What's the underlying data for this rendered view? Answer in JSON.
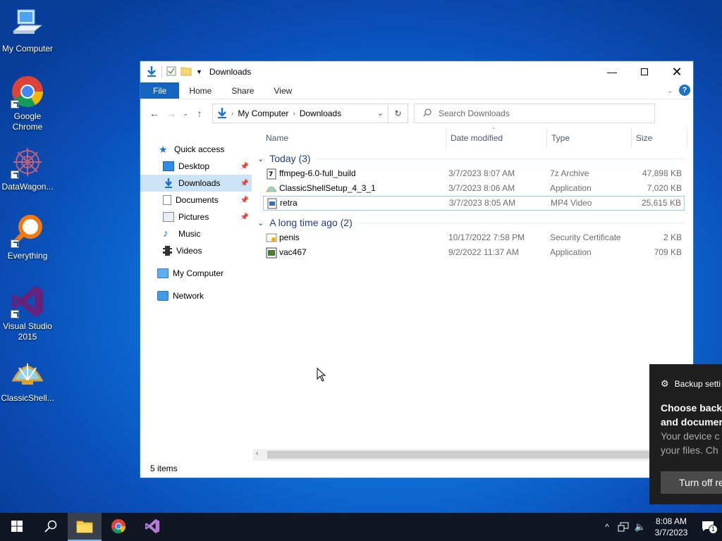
{
  "desktop": {
    "icons": [
      {
        "label": "My Computer",
        "icon": "computer-icon"
      },
      {
        "label": "Google Chrome",
        "icon": "chrome-icon"
      },
      {
        "label": "DataWagon...",
        "icon": "datawagon-icon"
      },
      {
        "label": "Everything",
        "icon": "search-magnifier-icon"
      },
      {
        "label": "Visual Studio 2015",
        "icon": "visual-studio-icon"
      },
      {
        "label": "ClassicShell...",
        "icon": "shell-icon"
      }
    ]
  },
  "window": {
    "title": "Downloads",
    "ribbon_tabs": [
      "File",
      "Home",
      "Share",
      "View"
    ],
    "help_label": "?",
    "breadcrumb": [
      "My Computer",
      "Downloads"
    ],
    "search_placeholder": "Search Downloads",
    "nav": {
      "quick_access": "Quick access",
      "items": [
        {
          "label": "Desktop",
          "pinned": true
        },
        {
          "label": "Downloads",
          "pinned": true,
          "selected": true
        },
        {
          "label": "Documents",
          "pinned": true
        },
        {
          "label": "Pictures",
          "pinned": true
        },
        {
          "label": "Music",
          "pinned": false
        },
        {
          "label": "Videos",
          "pinned": false
        }
      ],
      "my_computer": "My Computer",
      "network": "Network"
    },
    "columns": [
      "Name",
      "Date modified",
      "Type",
      "Size"
    ],
    "groups": [
      {
        "label": "Today (3)",
        "files": [
          {
            "name": "ffmpeg-6.0-full_build",
            "date": "3/7/2023 8:07 AM",
            "type": "7z Archive",
            "size": "47,898 KB"
          },
          {
            "name": "ClassicShellSetup_4_3_1",
            "date": "3/7/2023 8:06 AM",
            "type": "Application",
            "size": "7,020 KB"
          },
          {
            "name": "retra",
            "date": "3/7/2023 8:05 AM",
            "type": "MP4 Video",
            "size": "25,615 KB"
          }
        ]
      },
      {
        "label": "A long time ago (2)",
        "files": [
          {
            "name": "penis",
            "date": "10/17/2022 7:58 PM",
            "type": "Security Certificate",
            "size": "2 KB"
          },
          {
            "name": "vac467",
            "date": "9/2/2022 11:37 AM",
            "type": "Application",
            "size": "709 KB"
          }
        ]
      }
    ],
    "status": "5 items"
  },
  "notification": {
    "app": "Backup setti",
    "heading_line1": "Choose back",
    "heading_line2": "and documer",
    "body_line1": "Your device c",
    "body_line2": "your files. Ch",
    "button": "Turn off re"
  },
  "taskbar": {
    "time": "8:08 AM",
    "date": "3/7/2023",
    "notification_count": "1"
  },
  "colors": {
    "accent": "#1565c0",
    "selection": "#cce4f7",
    "taskbar": "#101622"
  }
}
